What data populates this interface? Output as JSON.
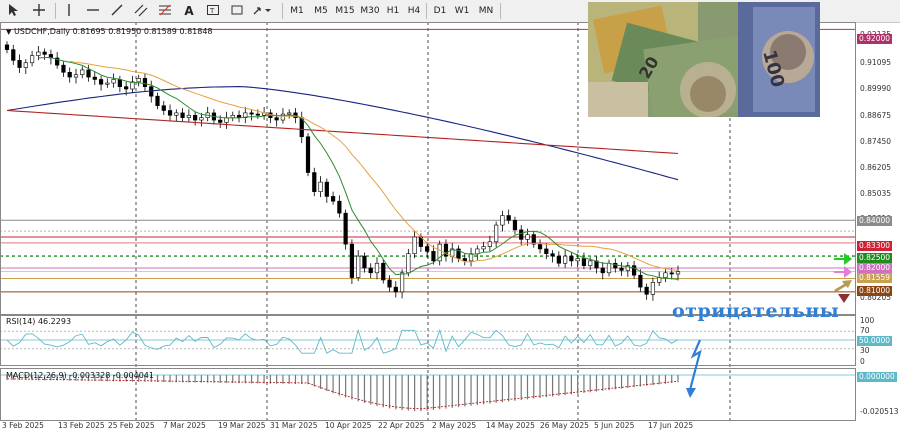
{
  "toolbar": {
    "timeframes": [
      "M1",
      "M5",
      "M15",
      "M30",
      "H1",
      "H4",
      "D1",
      "W1",
      "MN"
    ]
  },
  "symbol_info": {
    "text": "USDCHF,Daily  0.81695 0.81950 0.81589 0.81848"
  },
  "rsi": {
    "label": "RSI(14) 46.2293",
    "levels": [
      "100",
      "70",
      "30",
      "0"
    ],
    "level_tag": "50.0000"
  },
  "macd": {
    "label": "MACD(12,26,9) -0.003328 -0.004041",
    "tag": "0.000000",
    "bottom_label": "-0.020513"
  },
  "price_axis": [
    "0.92135",
    "0.91095",
    "0.89990",
    "0.88675",
    "0.87450",
    "0.86205",
    "0.85035",
    "0.83810",
    "0.82590",
    "0.81375",
    "0.80205"
  ],
  "price_tags": [
    {
      "text": "0.92000",
      "color": "#b0306a"
    },
    {
      "text": "0.84000",
      "color": "#8a8a8a"
    },
    {
      "text": "0.83300",
      "color": "#cc2233"
    },
    {
      "text": "0.82500",
      "color": "#1e8c1e"
    },
    {
      "text": "0.82000",
      "color": "#d070c0"
    },
    {
      "text": "0.81559",
      "color": "#c8a050"
    },
    {
      "text": "0.81000",
      "color": "#8b4513"
    }
  ],
  "x_labels": [
    "3 Feb 2025",
    "13 Feb 2025",
    "25 Feb 2025",
    "7 Mar 2025",
    "19 Mar 2025",
    "31 Mar 2025",
    "10 Apr 2025",
    "22 Apr 2025",
    "2 May 2025",
    "14 May 2025",
    "26 May 2025",
    "5 Jun 2025",
    "17 Jun 2025"
  ],
  "overlay_text": "отрицательны",
  "colors": {
    "ma_blue": "#1a237e",
    "ma_red": "#b22222",
    "ma_orange": "#e8a040",
    "ma_green": "#2e8b2e",
    "rsi_line": "#5fb8c8",
    "macd_signal": "#b22222",
    "annotation": "#2f7fd8"
  },
  "chart_data": {
    "type": "candlestick",
    "symbol": "USDCHF",
    "timeframe": "Daily",
    "ohlc_last": {
      "open": 0.81695,
      "high": 0.8195,
      "low": 0.81589,
      "close": 0.81848
    },
    "rsi_value": 46.2293,
    "macd_values": [
      -0.003328,
      -0.004041
    ],
    "horizontal_levels": [
      0.92,
      0.84,
      0.833,
      0.825,
      0.82,
      0.81559,
      0.81
    ]
  }
}
